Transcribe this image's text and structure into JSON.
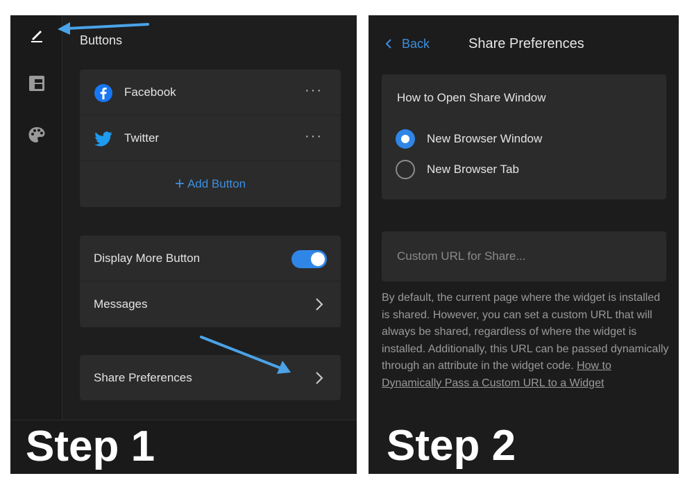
{
  "step1": {
    "section_title": "Buttons",
    "buttons": [
      {
        "label": "Facebook",
        "more": "···"
      },
      {
        "label": "Twitter",
        "more": "···"
      }
    ],
    "add_button": {
      "plus": "+",
      "label": "Add Button"
    },
    "display_more": {
      "label": "Display More Button",
      "enabled": true
    },
    "messages": {
      "label": "Messages"
    },
    "share_preferences": {
      "label": "Share Preferences"
    },
    "step_label": "Step 1"
  },
  "step2": {
    "back_label": "Back",
    "title": "Share Preferences",
    "open_window_title": "How to Open Share Window",
    "options": [
      {
        "label": "New Browser Window",
        "selected": true
      },
      {
        "label": "New Browser Tab",
        "selected": false
      }
    ],
    "url_placeholder": "Custom URL for Share...",
    "help_text": "By default, the current page where the widget is installed is shared. However, you can set a custom URL that will always be shared, regardless of where the widget is installed. Additionally, this URL can be passed dynamically through an attribute in the widget code. ",
    "help_link": "How to Dynamically Pass a Custom URL to a Widget",
    "step_label": "Step 2"
  },
  "colors": {
    "accent": "#2f86e6",
    "link": "#3d8fe0",
    "panel_bg": "#1e1e1e",
    "card_bg": "#2b2b2b",
    "annotation_arrow": "#4aa3e8"
  }
}
